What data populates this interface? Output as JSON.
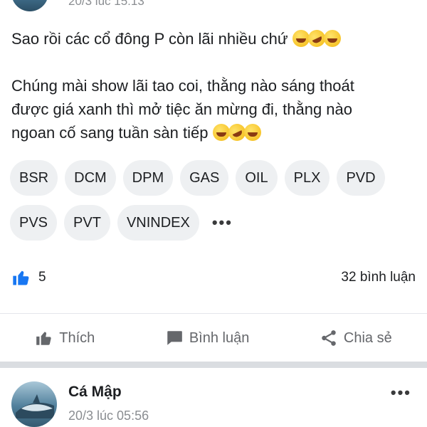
{
  "previous_post": {
    "time": "20/3 lúc 15:13"
  },
  "post": {
    "paragraph1": "Sao rồi các cổ đông P còn lãi nhiều chứ",
    "paragraph2_line1": "Chúng mài show lãi tao coi, thằng nào sáng thoát",
    "paragraph2_line2": "được giá xanh thì mở tiệc ăn mừng đi, thằng nào",
    "paragraph2_line3": "ngoan cố sang tuần sàn tiếp",
    "tags_row1": [
      "BSR",
      "DCM",
      "DPM",
      "GAS",
      "OIL",
      "PLX",
      "PVD"
    ],
    "tags_row2": [
      "PVS",
      "PVT",
      "VNINDEX"
    ],
    "more_tags": "•••",
    "like_count": "5",
    "comment_count": "32 bình luận"
  },
  "actions": {
    "like": "Thích",
    "comment": "Bình luận",
    "share": "Chia sẻ"
  },
  "next_post": {
    "author": "Cá Mập",
    "time": "20/3 lúc 05:56",
    "more": "•••"
  },
  "colors": {
    "like_blue": "#1877f2",
    "muted": "#65676b",
    "chip_bg": "#eef0f2"
  }
}
